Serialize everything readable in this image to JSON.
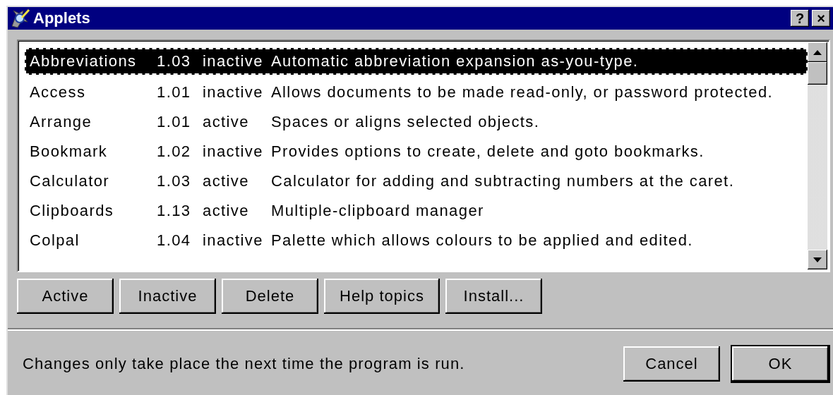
{
  "window": {
    "title": "Applets",
    "help_button": "?",
    "close_button": "×"
  },
  "applets": [
    {
      "name": "Abbreviations",
      "version": "1.03",
      "status": "inactive",
      "description": "Automatic abbreviation expansion as-you-type.",
      "selected": true
    },
    {
      "name": "Access",
      "version": "1.01",
      "status": "inactive",
      "description": "Allows documents to be made read-only, or password protected.",
      "selected": false
    },
    {
      "name": "Arrange",
      "version": "1.01",
      "status": "active",
      "description": "Spaces or aligns selected objects.",
      "selected": false
    },
    {
      "name": "Bookmark",
      "version": "1.02",
      "status": "inactive",
      "description": "Provides options to create, delete and goto bookmarks.",
      "selected": false
    },
    {
      "name": "Calculator",
      "version": "1.03",
      "status": "active",
      "description": "Calculator for adding and subtracting numbers at the caret.",
      "selected": false
    },
    {
      "name": "Clipboards",
      "version": "1.13",
      "status": "active",
      "description": "Multiple-clipboard manager",
      "selected": false
    },
    {
      "name": "Colpal",
      "version": "1.04",
      "status": "inactive",
      "description": "Palette which allows colours to be applied and edited.",
      "selected": false
    }
  ],
  "actions": [
    "Active",
    "Inactive",
    "Delete",
    "Help topics",
    "Install..."
  ],
  "note": "Changes only take place the next time the program is run.",
  "dialog_buttons": [
    {
      "label": "Cancel",
      "default": false
    },
    {
      "label": "OK",
      "default": true
    }
  ]
}
